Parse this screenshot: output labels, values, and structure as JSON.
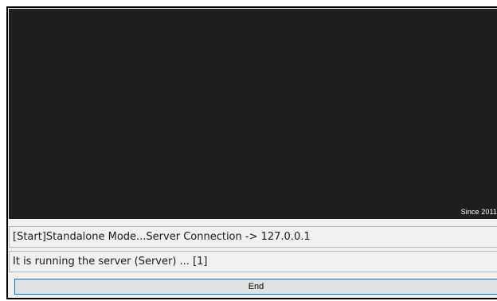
{
  "viewport": {
    "since_text": "Since 2011"
  },
  "status": {
    "line1": "[Start]Standalone Mode...Server Connection -> 127.0.0.1",
    "line2": "It is running the server (Server) ... [1]"
  },
  "actions": {
    "end_label": "End"
  },
  "colors": {
    "viewport_background": "#1e1e1e",
    "button_focus_border": "#0078d7"
  }
}
